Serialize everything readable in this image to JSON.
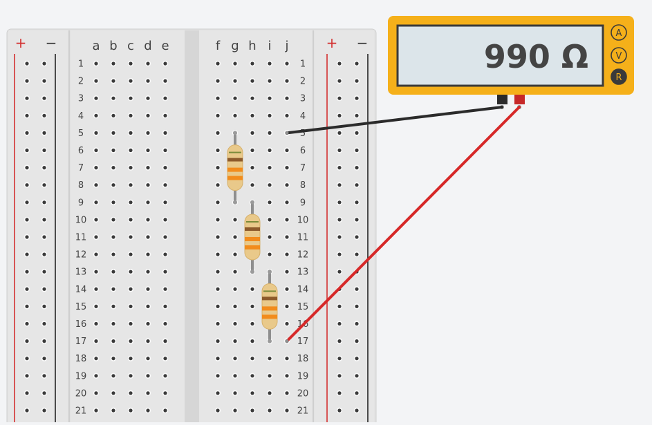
{
  "breadboard": {
    "rail_plus_label": "+",
    "rail_minus_label": "−",
    "left_columns": [
      "a",
      "b",
      "c",
      "d",
      "e"
    ],
    "right_columns": [
      "f",
      "g",
      "h",
      "i",
      "j"
    ],
    "row_numbers": [
      "1",
      "2",
      "3",
      "4",
      "5",
      "6",
      "7",
      "8",
      "9",
      "10",
      "11",
      "12",
      "13",
      "14",
      "15",
      "16",
      "17",
      "18",
      "19",
      "20",
      "21"
    ],
    "rail_plus_color": "#d32f2f",
    "rail_minus_color": "#222222"
  },
  "multimeter": {
    "display_value": "990 Ω",
    "mode_buttons": [
      "A",
      "V",
      "R"
    ],
    "active_mode": "R",
    "body_color": "#f5b01a",
    "display_color": "#dce5ea"
  },
  "resistors": [
    {
      "name": "resistor-1",
      "column": "g",
      "row_from": "5",
      "row_to": "9",
      "band_colors": [
        "#8d5a2b",
        "#f28c1c",
        "#f28c1c"
      ]
    },
    {
      "name": "resistor-2",
      "column": "h",
      "row_from": "9",
      "row_to": "13",
      "band_colors": [
        "#8d5a2b",
        "#f28c1c",
        "#f28c1c"
      ]
    },
    {
      "name": "resistor-3",
      "column": "i",
      "row_from": "13",
      "row_to": "17",
      "band_colors": [
        "#8d5a2b",
        "#f28c1c",
        "#f28c1c"
      ]
    }
  ],
  "probes": [
    {
      "name": "black-probe-wire",
      "color": "#2b2b2b",
      "to_column": "j",
      "to_row": "5"
    },
    {
      "name": "red-probe-wire",
      "color": "#d62828",
      "to_column": "j",
      "to_row": "17"
    }
  ]
}
